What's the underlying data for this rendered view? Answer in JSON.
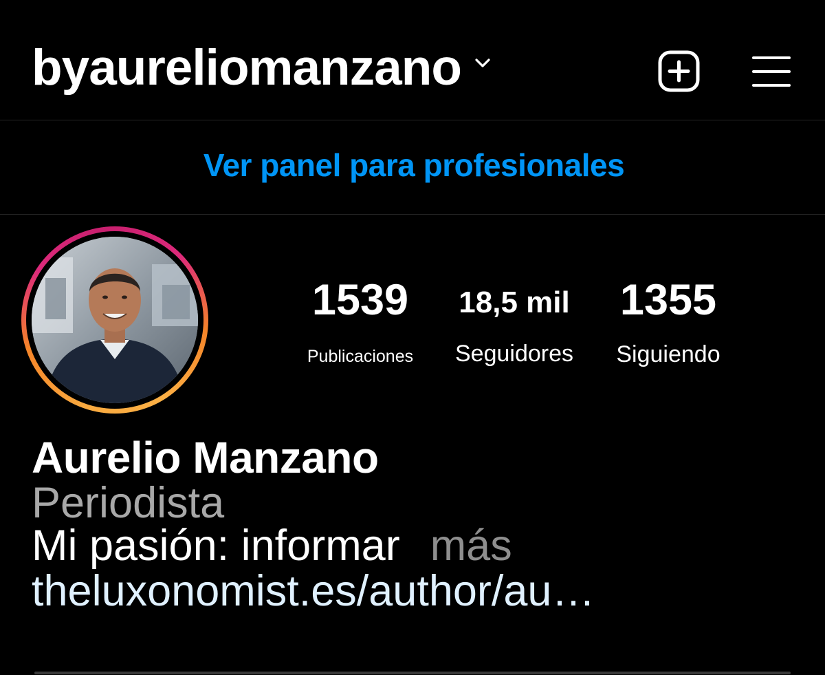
{
  "header": {
    "username": "byaureliomanzano",
    "chevron_icon": "chevron-down-icon",
    "new_post_icon": "plus-square-icon",
    "menu_icon": "hamburger-menu-icon"
  },
  "professional_dashboard": {
    "label": "Ver panel para profesionales",
    "color": "#0095f6"
  },
  "profile": {
    "avatar_icon": "profile-photo",
    "stats": {
      "posts": {
        "value": "1539",
        "label": "Publicaciones"
      },
      "followers": {
        "value": "18,5 mil",
        "label": "Seguidores"
      },
      "following": {
        "value": "1355",
        "label": "Siguiendo"
      }
    },
    "full_name": "Aurelio Manzano",
    "category": "Periodista",
    "bio": "Mi pasión: informar",
    "more_label": "más",
    "link": "theluxonomist.es/author/au…"
  },
  "colors": {
    "background": "#000000",
    "text": "#ffffff",
    "muted": "#a8a8a8",
    "link": "#e0f1ff",
    "ring_gradient": [
      "#f9a93f",
      "#dd2a7b",
      "#c71f6e"
    ]
  }
}
